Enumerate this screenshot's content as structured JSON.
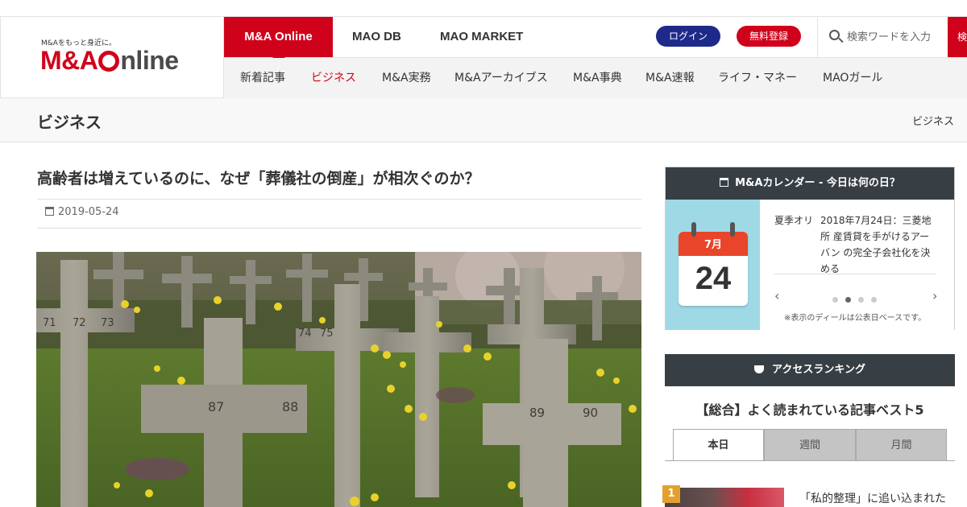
{
  "logo": {
    "tagline": "M&Aをもっと身近に。",
    "part1": "M&A",
    "part2": "nline"
  },
  "nav_top": {
    "tabs": [
      "M&A Online",
      "MAO DB",
      "MAO MARKET"
    ],
    "login_label": "ログイン",
    "register_label": "無料登録",
    "search_placeholder": "検索ワードを入力",
    "search_button_label": "検索"
  },
  "nav_sub": {
    "items": [
      "新着記事",
      "ビジネス",
      "M&A実務",
      "M&Aアーカイブス",
      "M&A事典",
      "M&A速報",
      "ライフ・マネー",
      "MAOガール"
    ],
    "active": "ビジネス"
  },
  "category": {
    "title": "ビジネス",
    "breadcrumb": "ビジネス"
  },
  "article": {
    "title": "高齢者は増えているのに、なぜ「葬儀社の倒産」が相次ぐのか？",
    "date": "2019-05-24",
    "cross_numbers": [
      "71",
      "72",
      "73",
      "74",
      "75",
      "87",
      "88",
      "89",
      "90"
    ]
  },
  "calendar_widget": {
    "header": "M&Aカレンダー - 今日は何の日？",
    "month": "7月",
    "day": "24",
    "deal_fragment": "夏季オリ 五輪）が",
    "deal_text": "2018年7月24日：三菱地所 産賃貸を手がけるアーバン の完全子会社化を決める",
    "prev_arrow": "‹",
    "next_arrow": "›",
    "note": "※表示のディールは公表日ベースです。",
    "slide_count": 4,
    "active_slide": 2
  },
  "ranking": {
    "header": "アクセスランキング",
    "title": "【総合】よく読まれている記事ベスト5",
    "tabs": [
      "本日",
      "週間",
      "月間"
    ],
    "active_tab": "本日",
    "items": [
      {
        "rank": "1",
        "title": "「私的整理」に追い込まれた"
      }
    ]
  },
  "colors": {
    "brand_red": "#d0021b",
    "login_blue": "#1e2a8a",
    "widget_header": "#383f44",
    "rank_gold": "#e2a12e",
    "calendar_bg": "#9fd9e6"
  }
}
